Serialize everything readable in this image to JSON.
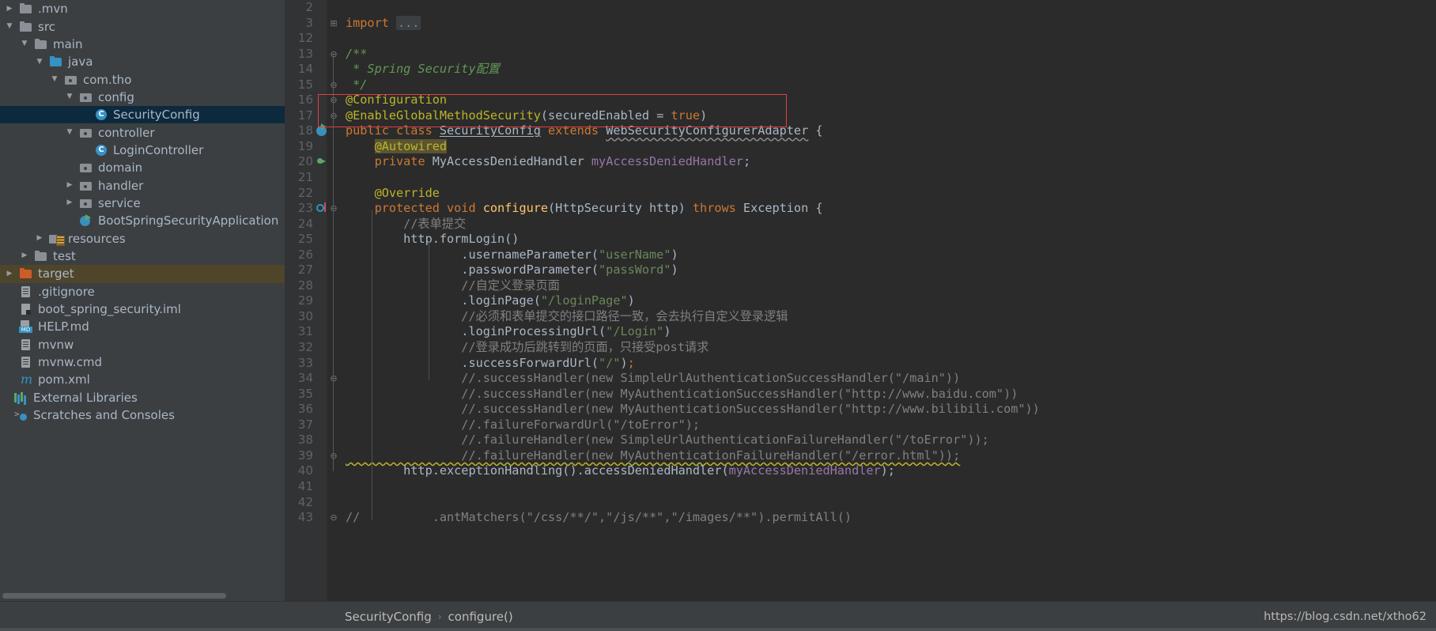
{
  "sidebar": {
    "name": "project-tree",
    "items": [
      {
        "label": ".mvn",
        "indent": 0,
        "twisty": "collapsed",
        "icon": "folder-icon",
        "state": "normal"
      },
      {
        "label": "src",
        "indent": 0,
        "twisty": "expanded",
        "icon": "folder-icon",
        "state": "normal"
      },
      {
        "label": "main",
        "indent": 1,
        "twisty": "expanded",
        "icon": "folder-icon",
        "state": "normal"
      },
      {
        "label": "java",
        "indent": 2,
        "twisty": "expanded",
        "icon": "source-folder-icon",
        "state": "normal"
      },
      {
        "label": "com.tho",
        "indent": 3,
        "twisty": "expanded",
        "icon": "package-icon",
        "state": "normal"
      },
      {
        "label": "config",
        "indent": 4,
        "twisty": "expanded",
        "icon": "package-icon",
        "state": "normal"
      },
      {
        "label": "SecurityConfig",
        "indent": 5,
        "twisty": "none",
        "icon": "java-class-icon",
        "state": "selected"
      },
      {
        "label": "controller",
        "indent": 4,
        "twisty": "expanded",
        "icon": "package-icon",
        "state": "normal"
      },
      {
        "label": "LoginController",
        "indent": 5,
        "twisty": "none",
        "icon": "java-class-icon",
        "state": "normal"
      },
      {
        "label": "domain",
        "indent": 4,
        "twisty": "none",
        "icon": "package-icon",
        "state": "normal"
      },
      {
        "label": "handler",
        "indent": 4,
        "twisty": "collapsed",
        "icon": "package-icon",
        "state": "normal"
      },
      {
        "label": "service",
        "indent": 4,
        "twisty": "collapsed",
        "icon": "package-icon",
        "state": "normal"
      },
      {
        "label": "BootSpringSecurityApplication",
        "indent": 4,
        "twisty": "none",
        "icon": "spring-boot-app-icon",
        "state": "normal"
      },
      {
        "label": "resources",
        "indent": 2,
        "twisty": "collapsed",
        "icon": "resources-folder-icon",
        "state": "normal"
      },
      {
        "label": "test",
        "indent": 1,
        "twisty": "collapsed",
        "icon": "folder-icon",
        "state": "normal"
      },
      {
        "label": "target",
        "indent": 0,
        "twisty": "collapsed",
        "icon": "excluded-folder-icon",
        "state": "highlight"
      },
      {
        "label": ".gitignore",
        "indent": 0,
        "twisty": "none",
        "icon": "file-icon",
        "state": "normal"
      },
      {
        "label": "boot_spring_security.iml",
        "indent": 0,
        "twisty": "none",
        "icon": "iml-file-icon",
        "state": "normal"
      },
      {
        "label": "HELP.md",
        "indent": 0,
        "twisty": "none",
        "icon": "markdown-file-icon",
        "state": "normal"
      },
      {
        "label": "mvnw",
        "indent": 0,
        "twisty": "none",
        "icon": "file-icon",
        "state": "normal"
      },
      {
        "label": "mvnw.cmd",
        "indent": 0,
        "twisty": "none",
        "icon": "file-icon",
        "state": "normal"
      },
      {
        "label": "pom.xml",
        "indent": 0,
        "twisty": "none",
        "icon": "maven-pom-icon",
        "state": "normal"
      },
      {
        "label": "External Libraries",
        "indent": -1,
        "twisty": "none",
        "icon": "external-libraries-icon",
        "state": "normal"
      },
      {
        "label": "Scratches and Consoles",
        "indent": -1,
        "twisty": "none",
        "icon": "scratches-icon",
        "state": "normal"
      }
    ]
  },
  "editor": {
    "name": "code-editor",
    "file": "SecurityConfig.java",
    "caret_line": 17,
    "lines": [
      {
        "num": "2",
        "gutter": "",
        "fold": "",
        "indent": 0,
        "tokens": []
      },
      {
        "num": "3",
        "gutter": "",
        "fold": "+",
        "indent": 0,
        "tokens": [
          {
            "t": "import ",
            "c": "t-kw"
          },
          {
            "t": "...",
            "c": "t-importdots"
          }
        ]
      },
      {
        "num": "12",
        "gutter": "",
        "fold": "",
        "indent": 0,
        "tokens": []
      },
      {
        "num": "13",
        "gutter": "",
        "fold": "⌐",
        "indent": 0,
        "tokens": [
          {
            "t": "/**",
            "c": "t-doc"
          }
        ]
      },
      {
        "num": "14",
        "gutter": "",
        "fold": "",
        "indent": 0,
        "tokens": [
          {
            "t": " * Spring Security配置",
            "c": "t-doc"
          }
        ]
      },
      {
        "num": "15",
        "gutter": "",
        "fold": "⌐",
        "indent": 0,
        "tokens": [
          {
            "t": " */",
            "c": "t-doc"
          }
        ]
      },
      {
        "num": "16",
        "gutter": "",
        "fold": "⌐",
        "indent": 0,
        "tokens": [
          {
            "t": "@Configuration",
            "c": "t-ann"
          }
        ]
      },
      {
        "num": "17",
        "gutter": "",
        "fold": "⌐",
        "indent": 0,
        "tokens": [
          {
            "t": "@EnableGlobalMethodSecurity",
            "c": "t-ann"
          },
          {
            "t": "(",
            "c": "t-plain"
          },
          {
            "t": "securedEnabled",
            "c": "t-plain"
          },
          {
            "t": " = ",
            "c": "t-plain"
          },
          {
            "t": "true",
            "c": "t-kw"
          },
          {
            "t": ")",
            "c": "t-plain"
          }
        ]
      },
      {
        "num": "18",
        "gutter": "bean",
        "fold": "",
        "indent": 0,
        "tokens": [
          {
            "t": "public class ",
            "c": "t-kw"
          },
          {
            "t": "SecurityConfig",
            "c": "t-cls-und"
          },
          {
            "t": " extends ",
            "c": "t-kw"
          },
          {
            "t": "WebSecurityConfigurerAdapter",
            "c": "wavy-grey"
          },
          {
            "t": " {",
            "c": "t-plain"
          }
        ]
      },
      {
        "num": "19",
        "gutter": "",
        "fold": "",
        "indent": 0,
        "tokens": [
          {
            "t": "    ",
            "c": "t-plain"
          },
          {
            "t": "@Autowired",
            "c": "t-ann-hl"
          }
        ]
      },
      {
        "num": "20",
        "gutter": "arrow",
        "fold": "",
        "indent": 0,
        "tokens": [
          {
            "t": "    ",
            "c": "t-plain"
          },
          {
            "t": "private ",
            "c": "t-kw"
          },
          {
            "t": "MyAccessDeniedHandler ",
            "c": "t-plain"
          },
          {
            "t": "myAccessDeniedHandler",
            "c": "t-field"
          },
          {
            "t": ";",
            "c": "t-plain"
          }
        ]
      },
      {
        "num": "21",
        "gutter": "",
        "fold": "",
        "indent": 0,
        "tokens": []
      },
      {
        "num": "22",
        "gutter": "",
        "fold": "",
        "indent": 0,
        "tokens": [
          {
            "t": "    ",
            "c": "t-plain"
          },
          {
            "t": "@Override",
            "c": "t-ann"
          }
        ]
      },
      {
        "num": "23",
        "gutter": "override",
        "fold": "⌐",
        "indent": 0,
        "tokens": [
          {
            "t": "    ",
            "c": "t-plain"
          },
          {
            "t": "protected void ",
            "c": "t-kw"
          },
          {
            "t": "configure",
            "c": "t-def"
          },
          {
            "t": "(HttpSecurity http) ",
            "c": "t-plain"
          },
          {
            "t": "throws ",
            "c": "t-kw"
          },
          {
            "t": "Exception {",
            "c": "t-plain"
          }
        ]
      },
      {
        "num": "24",
        "gutter": "",
        "fold": "",
        "indent": 0,
        "tokens": [
          {
            "t": "        //表单提交",
            "c": "t-cmt"
          }
        ]
      },
      {
        "num": "25",
        "gutter": "",
        "fold": "",
        "indent": 0,
        "tokens": [
          {
            "t": "        http.formLogin()",
            "c": "t-plain"
          }
        ]
      },
      {
        "num": "26",
        "gutter": "",
        "fold": "",
        "indent": 0,
        "tokens": [
          {
            "t": "                .usernameParameter(",
            "c": "t-plain"
          },
          {
            "t": "\"userName\"",
            "c": "t-str"
          },
          {
            "t": ")",
            "c": "t-plain"
          }
        ]
      },
      {
        "num": "27",
        "gutter": "",
        "fold": "",
        "indent": 0,
        "tokens": [
          {
            "t": "                .passwordParameter(",
            "c": "t-plain"
          },
          {
            "t": "\"passWord\"",
            "c": "t-str"
          },
          {
            "t": ")",
            "c": "t-plain"
          }
        ]
      },
      {
        "num": "28",
        "gutter": "",
        "fold": "",
        "indent": 0,
        "tokens": [
          {
            "t": "                //自定义登录页面",
            "c": "t-cmt"
          }
        ]
      },
      {
        "num": "29",
        "gutter": "",
        "fold": "",
        "indent": 0,
        "tokens": [
          {
            "t": "                .loginPage(",
            "c": "t-plain"
          },
          {
            "t": "\"/loginPage\"",
            "c": "t-str"
          },
          {
            "t": ")",
            "c": "t-plain"
          }
        ]
      },
      {
        "num": "30",
        "gutter": "",
        "fold": "",
        "indent": 0,
        "tokens": [
          {
            "t": "                //必须和表单提交的接口路径一致，会去执行自定义登录逻辑",
            "c": "t-cmt"
          }
        ]
      },
      {
        "num": "31",
        "gutter": "",
        "fold": "",
        "indent": 0,
        "tokens": [
          {
            "t": "                .loginProcessingUrl(",
            "c": "t-plain"
          },
          {
            "t": "\"/Login\"",
            "c": "t-str"
          },
          {
            "t": ")",
            "c": "t-plain"
          }
        ]
      },
      {
        "num": "32",
        "gutter": "",
        "fold": "",
        "indent": 0,
        "tokens": [
          {
            "t": "                //登录成功后跳转到的页面，只接受post请求",
            "c": "t-cmt"
          }
        ]
      },
      {
        "num": "33",
        "gutter": "",
        "fold": "",
        "indent": 0,
        "tokens": [
          {
            "t": "                .successForwardUrl(",
            "c": "t-plain"
          },
          {
            "t": "\"/\"",
            "c": "t-str"
          },
          {
            "t": ")",
            "c": "t-plain"
          },
          {
            "t": ";",
            "c": "t-kw"
          }
        ]
      },
      {
        "num": "34",
        "gutter": "",
        "fold": "⌐",
        "indent": 0,
        "tokens": [
          {
            "t": "                //.successHandler(new SimpleUrlAuthenticationSuccessHandler(\"/main\"))",
            "c": "t-cmt"
          }
        ]
      },
      {
        "num": "35",
        "gutter": "",
        "fold": "",
        "indent": 0,
        "tokens": [
          {
            "t": "                //.successHandler(new MyAuthenticationSuccessHandler(\"http://www.baidu.com\"))",
            "c": "t-cmt"
          }
        ]
      },
      {
        "num": "36",
        "gutter": "",
        "fold": "",
        "indent": 0,
        "tokens": [
          {
            "t": "                //.successHandler(new MyAuthenticationSuccessHandler(\"http://www.bilibili.com\"))",
            "c": "t-cmt"
          }
        ]
      },
      {
        "num": "37",
        "gutter": "",
        "fold": "",
        "indent": 0,
        "tokens": [
          {
            "t": "                //.failureForwardUrl(\"/toError\");",
            "c": "t-cmt"
          }
        ]
      },
      {
        "num": "38",
        "gutter": "",
        "fold": "",
        "indent": 0,
        "tokens": [
          {
            "t": "                //.failureHandler(new SimpleUrlAuthenticationFailureHandler(\"/toError\"));",
            "c": "t-cmt"
          }
        ]
      },
      {
        "num": "39",
        "gutter": "",
        "fold": "⌐",
        "indent": 0,
        "tokens": [
          {
            "t": "                //.failureHandler(new MyAuthenticationFailureHandler(\"/error.html\"));",
            "c": "t-cmt wavy-warn"
          }
        ]
      },
      {
        "num": "40",
        "gutter": "",
        "fold": "",
        "indent": 0,
        "tokens": [
          {
            "t": "        http.exceptionHandling().accessDeniedHandler(",
            "c": "t-plain"
          },
          {
            "t": "myAccessDeniedHandler",
            "c": "t-field"
          },
          {
            "t": ");",
            "c": "t-plain"
          }
        ]
      },
      {
        "num": "41",
        "gutter": "",
        "fold": "",
        "indent": 0,
        "tokens": []
      },
      {
        "num": "42",
        "gutter": "",
        "fold": "",
        "indent": 0,
        "tokens": []
      },
      {
        "num": "43",
        "gutter": "",
        "fold": "⌐",
        "indent": 0,
        "tokens": [
          {
            "t": "//          .antMatchers(\"/css/**/\",\"/js/**\",\"/images/**\").permitAll()",
            "c": "t-cmt"
          }
        ]
      }
    ]
  },
  "bottom_bar": {
    "name": "breadcrumb-bar",
    "breadcrumb": [
      "SecurityConfig",
      "configure()"
    ],
    "separator": "›",
    "watermark": "https://blog.csdn.net/xtho62"
  },
  "colors": {
    "sidebar_bg": "#3c3f41",
    "editor_bg": "#2b2b2b",
    "gutter_bg": "#313335",
    "selection": "#0d293e",
    "target_highlight": "#4e452b",
    "annotation": "#bbb529",
    "keyword": "#cc7832",
    "string": "#6a8759",
    "comment": "#808080",
    "field": "#9876aa",
    "method_def": "#ffc66d",
    "red_box": "#e04040",
    "text": "#a9b7c6"
  }
}
